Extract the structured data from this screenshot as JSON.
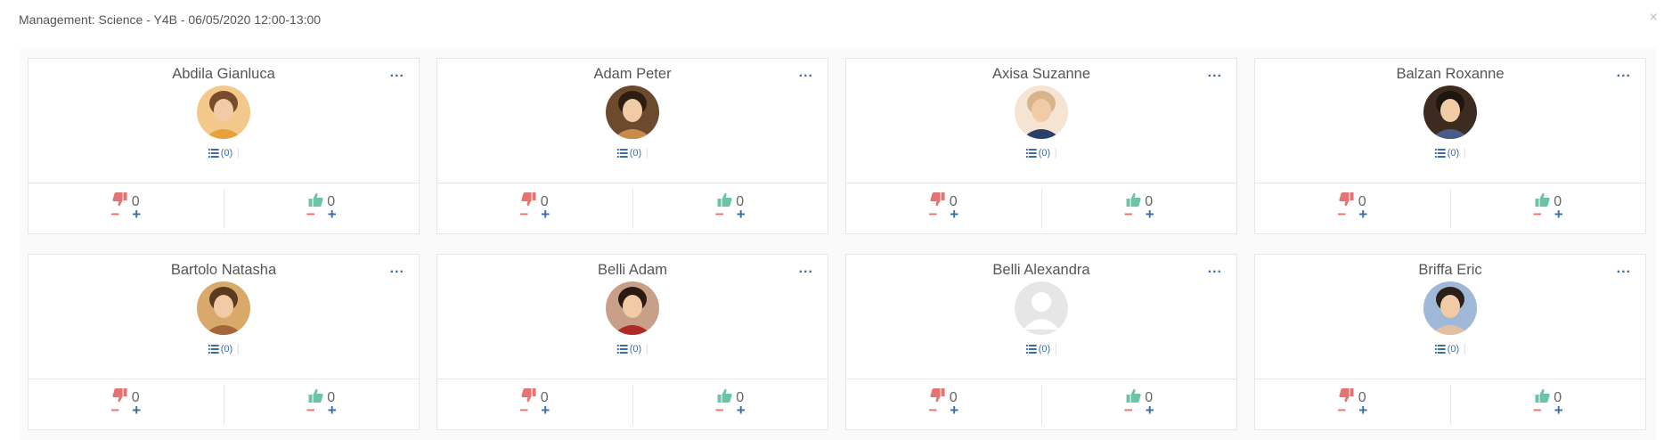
{
  "modal": {
    "title": "Management: Science - Y4B - 06/05/2020 12:00-13:00",
    "close_label": "×"
  },
  "more_label": "...",
  "minus_label": "−",
  "plus_label": "+",
  "colors": {
    "negative": "#e57373",
    "positive": "#6cc4a8",
    "link": "#3a6ea5"
  },
  "students": [
    {
      "name": "Abdila Gianluca",
      "list_count": "(0)",
      "negative": "0",
      "positive": "0",
      "avatar": "photo"
    },
    {
      "name": "Adam Peter",
      "list_count": "(0)",
      "negative": "0",
      "positive": "0",
      "avatar": "photo"
    },
    {
      "name": "Axisa Suzanne",
      "list_count": "(0)",
      "negative": "0",
      "positive": "0",
      "avatar": "photo"
    },
    {
      "name": "Balzan Roxanne",
      "list_count": "(0)",
      "negative": "0",
      "positive": "0",
      "avatar": "photo"
    },
    {
      "name": "Bartolo Natasha",
      "list_count": "(0)",
      "negative": "0",
      "positive": "0",
      "avatar": "photo"
    },
    {
      "name": "Belli Adam",
      "list_count": "(0)",
      "negative": "0",
      "positive": "0",
      "avatar": "photo"
    },
    {
      "name": "Belli Alexandra",
      "list_count": "(0)",
      "negative": "0",
      "positive": "0",
      "avatar": "placeholder"
    },
    {
      "name": "Briffa Eric",
      "list_count": "(0)",
      "negative": "0",
      "positive": "0",
      "avatar": "photo"
    }
  ]
}
